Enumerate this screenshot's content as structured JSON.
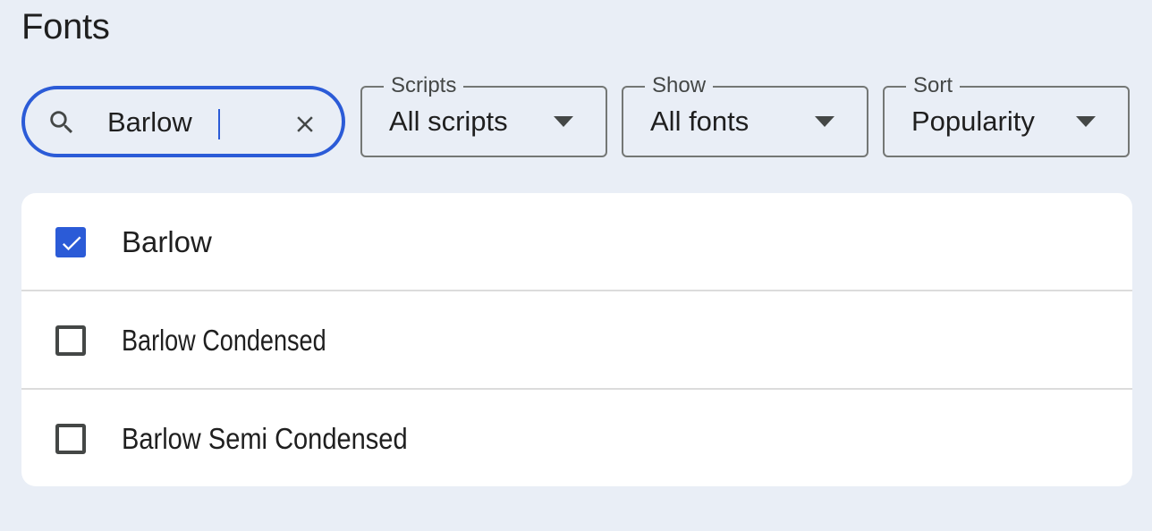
{
  "page": {
    "title": "Fonts"
  },
  "search": {
    "value": "Barlow",
    "placeholder": "Search fonts",
    "search_icon": "search-icon",
    "clear_icon": "close-icon"
  },
  "filters": [
    {
      "label": "Scripts",
      "value": "All scripts"
    },
    {
      "label": "Show",
      "value": "All fonts"
    },
    {
      "label": "Sort",
      "value": "Popularity"
    }
  ],
  "results": [
    {
      "name": "Barlow",
      "checked": true
    },
    {
      "name": "Barlow Condensed",
      "checked": false
    },
    {
      "name": "Barlow Semi Condensed",
      "checked": false
    }
  ],
  "colors": {
    "background": "#e9eef6",
    "accent": "#2b5bd7",
    "card": "#ffffff",
    "text": "#1f1f1f"
  }
}
